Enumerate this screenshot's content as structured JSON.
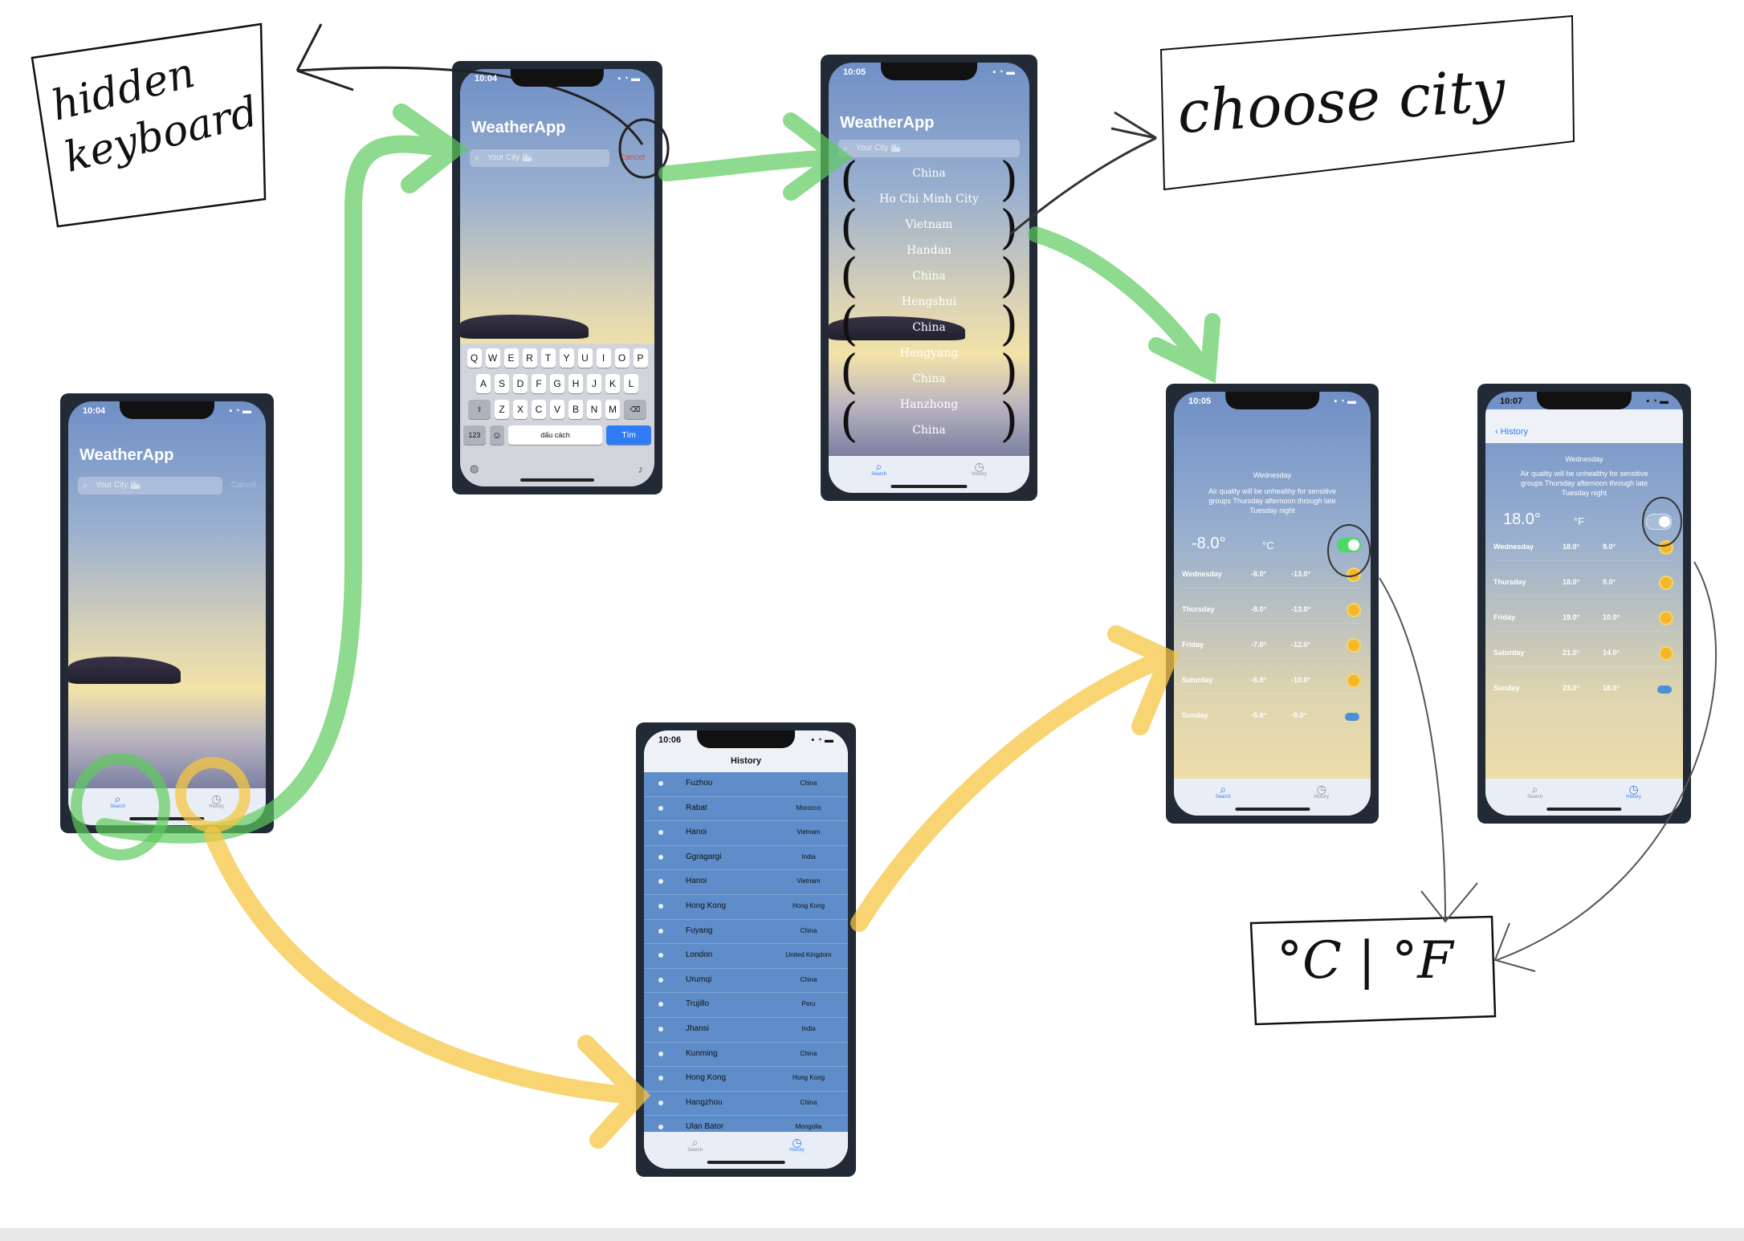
{
  "annotations": {
    "hidden_keyboard": [
      "hidden",
      "keyboard"
    ],
    "choose_city": "choose city",
    "unit_switch": "°C | °F"
  },
  "colors": {
    "green_arrow": "#5ecb5e",
    "yellow_arrow": "#f6c644",
    "tab_active": "#2f7cf6",
    "history_list_bg": "#5e8dc9",
    "cancel_red": "#d94a4a"
  },
  "screen_home": {
    "time": "10:04",
    "app_title": "WeatherApp",
    "search_placeholder": "Your City 🏙",
    "cancel_label": "Cancel",
    "tabs": [
      {
        "label": "Search",
        "icon": "search-icon",
        "active": true
      },
      {
        "label": "History",
        "icon": "clock-icon",
        "active": false
      }
    ]
  },
  "screen_keyboard": {
    "time": "10:04",
    "app_title": "WeatherApp",
    "search_placeholder": "Your City 🏙",
    "cancel_label": "Cancel",
    "keys_row1": [
      "Q",
      "W",
      "E",
      "R",
      "T",
      "Y",
      "U",
      "I",
      "O",
      "P"
    ],
    "keys_row2": [
      "A",
      "S",
      "D",
      "F",
      "G",
      "H",
      "J",
      "K",
      "L"
    ],
    "keys_row3": [
      "Z",
      "X",
      "C",
      "V",
      "B",
      "N",
      "M"
    ],
    "numbers_key": "123",
    "space_key": "dấu cách",
    "go_key": "Tìm"
  },
  "screen_picker": {
    "time": "10:05",
    "app_title": "WeatherApp",
    "search_placeholder": "Your City 🏙",
    "items": [
      "China",
      "Ho Chi Minh City",
      "Vietnam",
      "Handan",
      "China",
      "Hengshui",
      "China",
      "Hengyang",
      "China",
      "Hanzhong",
      "China"
    ],
    "tabs": [
      {
        "label": "Search",
        "icon": "search-icon",
        "active": true
      },
      {
        "label": "History",
        "icon": "clock-icon",
        "active": false
      }
    ]
  },
  "screen_history": {
    "time": "10:06",
    "title": "History",
    "rows": [
      {
        "city": "Fuzhou",
        "country": "China"
      },
      {
        "city": "Rabat",
        "country": "Morocco"
      },
      {
        "city": "Hanoi",
        "country": "Vietnam"
      },
      {
        "city": "Ggragargi",
        "country": "India"
      },
      {
        "city": "Hanoi",
        "country": "Vietnam"
      },
      {
        "city": "Hong Kong",
        "country": "Hong Kong"
      },
      {
        "city": "Fuyang",
        "country": "China"
      },
      {
        "city": "London",
        "country": "United Kingdom"
      },
      {
        "city": "Urumqi",
        "country": "China"
      },
      {
        "city": "Trujillo",
        "country": "Peru"
      },
      {
        "city": "Jhansi",
        "country": "India"
      },
      {
        "city": "Kunming",
        "country": "China"
      },
      {
        "city": "Hong Kong",
        "country": "Hong Kong"
      },
      {
        "city": "Hangzhou",
        "country": "China"
      },
      {
        "city": "Ulan Bator",
        "country": "Mongolia"
      }
    ],
    "tabs": [
      {
        "label": "Search",
        "icon": "search-icon",
        "active": false
      },
      {
        "label": "History",
        "icon": "clock-icon",
        "active": true
      }
    ]
  },
  "screen_detail_c": {
    "time": "10:05",
    "day": "Wednesday",
    "description": "Air quality will be unhealthy for sensitive groups Thursday afternoon through late Tuesday night",
    "temp": "-8.0°",
    "unit": "°C",
    "toggle_on": true,
    "forecast": [
      {
        "day": "Wednesday",
        "high": "-8.0°",
        "low": "-13.0°",
        "icon": "sun-icon"
      },
      {
        "day": "Thursday",
        "high": "-8.0°",
        "low": "-13.0°",
        "icon": "sun-icon"
      },
      {
        "day": "Friday",
        "high": "-7.0°",
        "low": "-12.0°",
        "icon": "sun-icon"
      },
      {
        "day": "Saturday",
        "high": "-6.0°",
        "low": "-10.0°",
        "icon": "sun-icon"
      },
      {
        "day": "Sunday",
        "high": "-5.0°",
        "low": "-9.0°",
        "icon": "cloud-icon"
      }
    ],
    "tabs": [
      {
        "label": "Search",
        "icon": "search-icon",
        "active": true
      },
      {
        "label": "History",
        "icon": "clock-icon",
        "active": false
      }
    ]
  },
  "screen_detail_f": {
    "time": "10:07",
    "back_label": "History",
    "day": "Wednesday",
    "description": "Air quality will be unhealthy for sensitive groups Thursday afternoon through late Tuesday night",
    "temp": "18.0°",
    "unit": "°F",
    "toggle_on": false,
    "forecast": [
      {
        "day": "Wednesday",
        "high": "18.0°",
        "low": "9.0°",
        "icon": "sun-icon"
      },
      {
        "day": "Thursday",
        "high": "18.0°",
        "low": "9.0°",
        "icon": "sun-icon"
      },
      {
        "day": "Friday",
        "high": "19.0°",
        "low": "10.0°",
        "icon": "sun-icon"
      },
      {
        "day": "Saturday",
        "high": "21.0°",
        "low": "14.0°",
        "icon": "sun-icon"
      },
      {
        "day": "Sunday",
        "high": "23.0°",
        "low": "16.0°",
        "icon": "cloud-icon"
      }
    ],
    "tabs": [
      {
        "label": "Search",
        "icon": "search-icon",
        "active": false
      },
      {
        "label": "History",
        "icon": "clock-icon",
        "active": true
      }
    ]
  }
}
